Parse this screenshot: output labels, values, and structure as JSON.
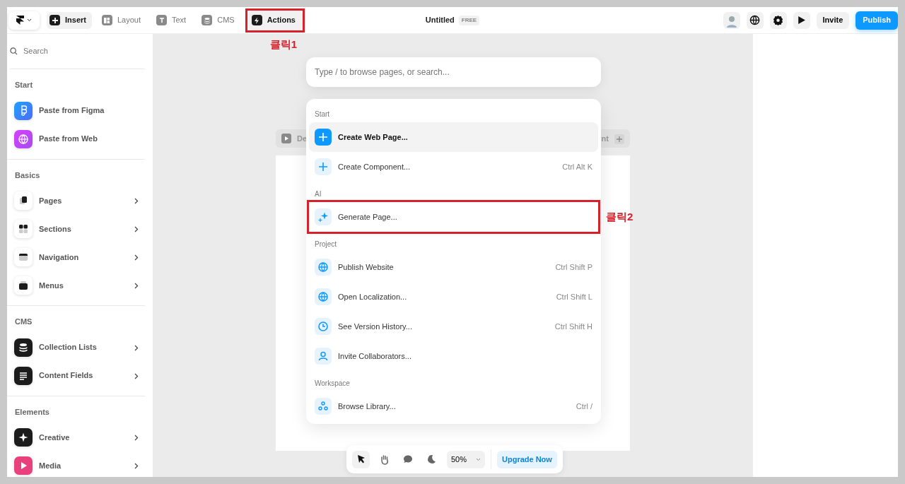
{
  "topbar": {
    "tabs": [
      {
        "label": "Insert",
        "kind": "plus",
        "selected": true
      },
      {
        "label": "Layout",
        "kind": "layout",
        "selected": false
      },
      {
        "label": "Text",
        "kind": "text",
        "selected": false
      },
      {
        "label": "CMS",
        "kind": "database",
        "selected": false
      },
      {
        "label": "Actions",
        "kind": "bolt",
        "selected": true,
        "annotation": "클릭1"
      }
    ],
    "title": "Untitled",
    "plan_badge": "FREE",
    "invite": "Invite",
    "publish": "Publish"
  },
  "sidebar": {
    "search": {
      "placeholder": "Search"
    },
    "sections": [
      {
        "title": "Start",
        "items": [
          {
            "label": "Paste from Figma",
            "kind": "figma",
            "submenu": false
          },
          {
            "label": "Paste from Web",
            "kind": "web",
            "submenu": false
          }
        ]
      },
      {
        "title": "Basics",
        "items": [
          {
            "label": "Pages",
            "kind": "pages",
            "submenu": true
          },
          {
            "label": "Sections",
            "kind": "sections",
            "submenu": true
          },
          {
            "label": "Navigation",
            "kind": "navigation",
            "submenu": true
          },
          {
            "label": "Menus",
            "kind": "menus",
            "submenu": true
          }
        ]
      },
      {
        "title": "CMS",
        "items": [
          {
            "label": "Collection Lists",
            "kind": "collection",
            "submenu": true
          },
          {
            "label": "Content Fields",
            "kind": "content",
            "submenu": true
          }
        ]
      },
      {
        "title": "Elements",
        "items": [
          {
            "label": "Creative",
            "kind": "creative",
            "submenu": true
          },
          {
            "label": "Media",
            "kind": "media",
            "submenu": true
          }
        ]
      }
    ]
  },
  "canvas": {
    "bar_left": "De",
    "bar_right": "nt"
  },
  "palette": {
    "search": {
      "placeholder": "Type / to browse pages, or search..."
    },
    "groups": [
      {
        "title": "Start",
        "items": [
          {
            "label": "Create Web Page...",
            "kind": "plus",
            "selected": true
          },
          {
            "label": "Create Component...",
            "kind": "plus",
            "shortcut": "Ctrl Alt K",
            "selected": false
          }
        ]
      },
      {
        "title": "AI",
        "items": [
          {
            "label": "Generate Page...",
            "kind": "sparkle",
            "selected": false,
            "annotation": "클릭2"
          }
        ]
      },
      {
        "title": "Project",
        "items": [
          {
            "label": "Publish Website",
            "kind": "globe",
            "shortcut": "Ctrl Shift P",
            "selected": false
          },
          {
            "label": "Open Localization...",
            "kind": "globe",
            "shortcut": "Ctrl Shift L",
            "selected": false
          },
          {
            "label": "See Version History...",
            "kind": "clock",
            "shortcut": "Ctrl Shift H",
            "selected": false
          },
          {
            "label": "Invite Collaborators...",
            "kind": "person",
            "selected": false
          }
        ]
      },
      {
        "title": "Workspace",
        "items": [
          {
            "label": "Browse Library...",
            "kind": "circles",
            "shortcut": "Ctrl /",
            "selected": false
          }
        ]
      }
    ]
  },
  "bottom_toolbar": {
    "tools": [
      {
        "kind": "pointer",
        "selected": true
      },
      {
        "kind": "hand",
        "selected": false
      },
      {
        "kind": "comment",
        "selected": false
      },
      {
        "kind": "moon",
        "selected": false
      }
    ],
    "zoom": "50%",
    "upgrade": "Upgrade Now"
  }
}
